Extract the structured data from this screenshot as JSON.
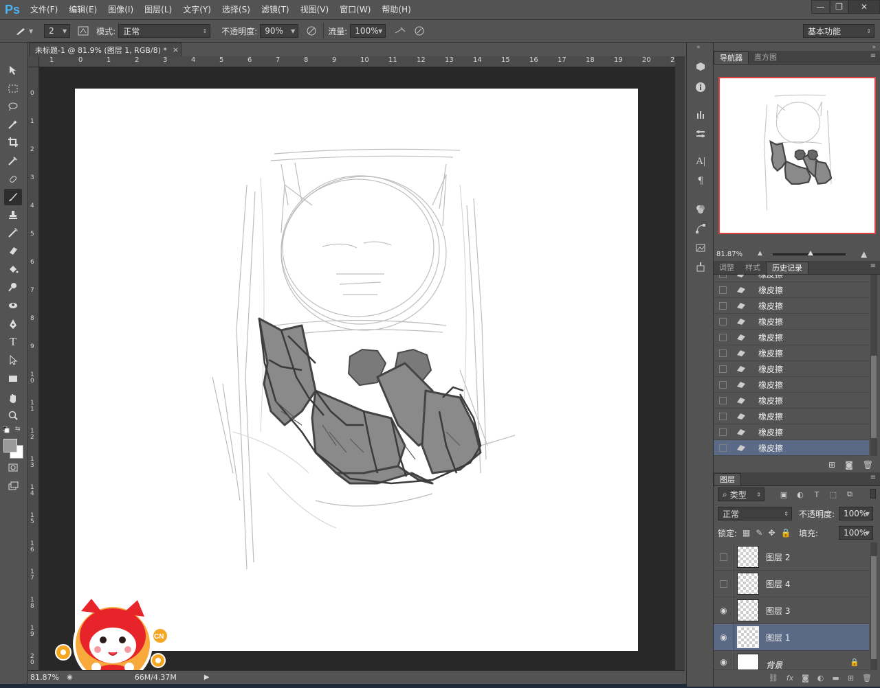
{
  "app": {
    "logo": "Ps"
  },
  "menu": [
    "文件(F)",
    "编辑(E)",
    "图像(I)",
    "图层(L)",
    "文字(Y)",
    "选择(S)",
    "滤镜(T)",
    "视图(V)",
    "窗口(W)",
    "帮助(H)"
  ],
  "window_controls": {
    "minimize": "—",
    "restore": "❐",
    "close": "✕"
  },
  "options": {
    "brush_size": "2",
    "mode_label": "模式:",
    "mode_value": "正常",
    "opacity_label": "不透明度:",
    "opacity_value": "90%",
    "flow_label": "流量:",
    "flow_value": "100%",
    "workspace": "基本功能"
  },
  "document": {
    "tab_title": "未标题-1 @ 81.9% (图层 1, RGB/8) *",
    "tab_close": "×",
    "ruler_top": [
      "1",
      "0",
      "1",
      "2",
      "3",
      "4",
      "5",
      "6",
      "7",
      "8",
      "9",
      "10",
      "11",
      "12",
      "13",
      "14",
      "15",
      "16",
      "17",
      "18",
      "19",
      "20",
      "2"
    ],
    "ruler_left": [
      "0",
      "1",
      "2",
      "3",
      "4",
      "5",
      "6",
      "7",
      "8",
      "9",
      "10",
      "11",
      "12",
      "13",
      "14",
      "15",
      "16",
      "17",
      "18",
      "19",
      "20"
    ]
  },
  "status": {
    "zoom": "81.87%",
    "doc_info": "66M/4.37M"
  },
  "mascot": {
    "badge": "CN"
  },
  "navigator": {
    "tabs": [
      "导航器",
      "直方图"
    ],
    "zoom": "81.87%"
  },
  "history": {
    "tabs": [
      "调整",
      "样式",
      "历史记录"
    ],
    "items": [
      "橡皮擦",
      "橡皮擦",
      "橡皮擦",
      "橡皮擦",
      "橡皮擦",
      "橡皮擦",
      "橡皮擦",
      "橡皮擦",
      "橡皮擦",
      "橡皮擦",
      "橡皮擦",
      "橡皮擦"
    ]
  },
  "layers": {
    "tab": "图层",
    "filter": "类型",
    "blend": "正常",
    "opacity_label": "不透明度:",
    "opacity_value": "100%",
    "lock_label": "锁定:",
    "fill_label": "填充:",
    "fill_value": "100%",
    "items": [
      {
        "name": "图层 2",
        "visible": false
      },
      {
        "name": "图层 4",
        "visible": false
      },
      {
        "name": "图层 3",
        "visible": true
      },
      {
        "name": "图层 1",
        "visible": true
      },
      {
        "name": "背景",
        "visible": true
      }
    ]
  },
  "colors": {
    "accent_selection": "#5a6a86",
    "navigator_frame": "#e04040",
    "ps_logo": "#4fb2f2"
  }
}
